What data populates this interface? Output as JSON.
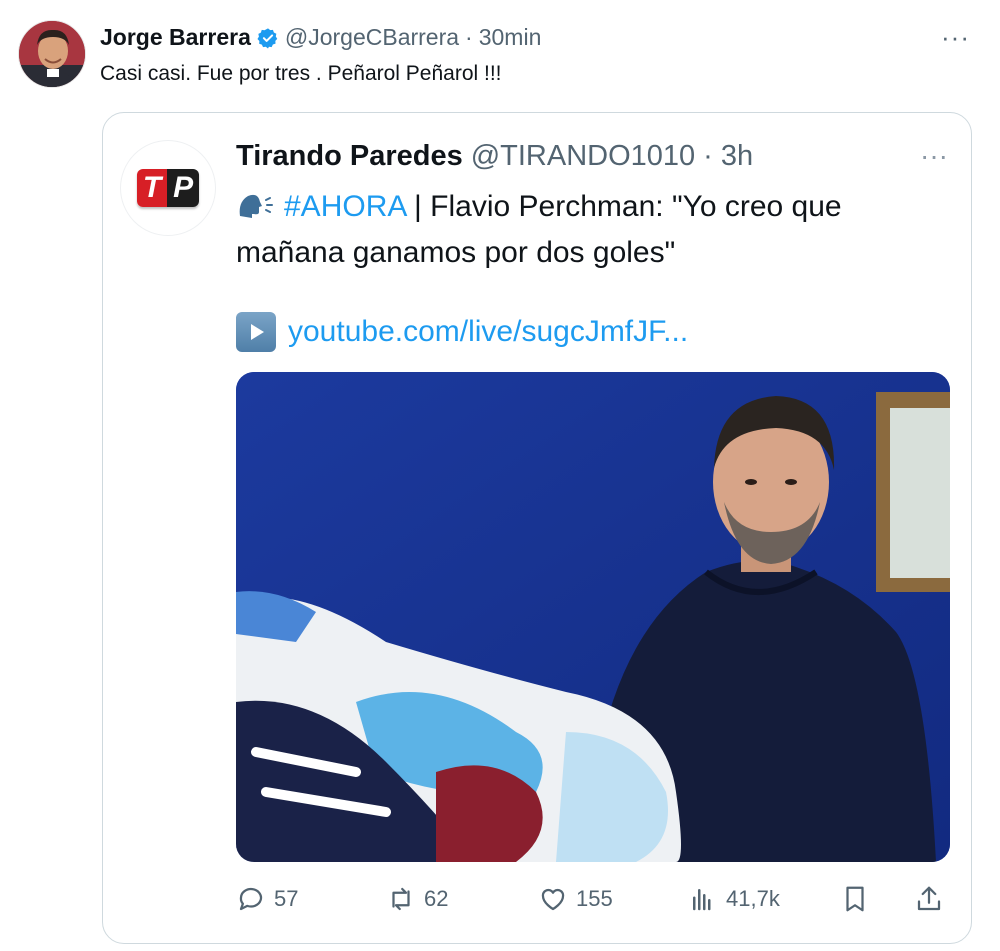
{
  "outer_tweet": {
    "author_name": "Jorge Barrera",
    "handle": "@JorgeCBarrera",
    "separator": "·",
    "time": "30min",
    "text": "Casi casi.  Fue por tres . Peñarol Peñarol !!!",
    "more_label": "···"
  },
  "quoted_tweet": {
    "author_name": "Tirando Paredes",
    "handle": "@TIRANDO1010",
    "separator": "·",
    "time": "3h",
    "logo_text_t": "T",
    "logo_text_p": "P",
    "hashtag": "#AHORA",
    "text": " | Flavio Perchman: \"Yo creo que mañana ganamos por dos goles\"",
    "link": "youtube.com/live/sugcJmfJF...",
    "more_label": "···"
  },
  "actions": {
    "replies": "57",
    "retweets": "62",
    "likes": "155",
    "views": "41,7k"
  },
  "colors": {
    "accent": "#1d9bf0",
    "muted": "#536471",
    "border": "#cfd9de",
    "wall_blue": "#1d3fa8"
  },
  "icons": [
    "verified-badge-icon",
    "more-icon",
    "speaking-head-icon",
    "play-icon",
    "reply-icon",
    "retweet-icon",
    "like-icon",
    "views-icon",
    "bookmark-icon",
    "share-icon"
  ]
}
